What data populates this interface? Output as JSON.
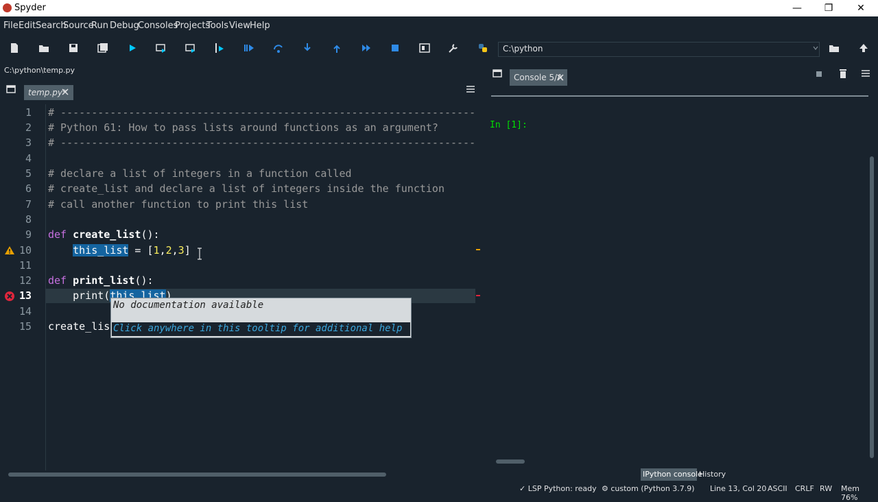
{
  "window": {
    "title": "Spyder",
    "minimize": "—",
    "maximize": "❐",
    "close": "✕"
  },
  "menu": [
    "File",
    "Edit",
    "Search",
    "Source",
    "Run",
    "Debug",
    "Consoles",
    "Projects",
    "Tools",
    "View",
    "Help"
  ],
  "toolbar": {
    "working_dir": "C:\\python",
    "icons": [
      "new-file-icon",
      "open-folder-icon",
      "save-icon",
      "save-all-icon",
      "run-icon",
      "run-cell-icon",
      "run-cell-advance-icon",
      "run-selection-icon",
      "debug-icon",
      "step-icon",
      "step-into-icon",
      "step-return-icon",
      "continue-icon",
      "stop-icon",
      "maximize-pane-icon",
      "preferences-icon",
      "python-path-icon"
    ]
  },
  "editor": {
    "path": "C:\\python\\temp.py",
    "tab_label": "temp.py*",
    "lines": [
      "1",
      "2",
      "3",
      "4",
      "5",
      "6",
      "7",
      "8",
      "9",
      "10",
      "11",
      "12",
      "13",
      "14",
      "15"
    ],
    "code": {
      "l1": "# -----------------------------------------------------------------------",
      "l2": "# Python 61: How to pass lists around functions as an argument?",
      "l3": "# -----------------------------------------------------------------------",
      "l5": "# declare a list of integers in a function called",
      "l6": "# create_list and declare a list of integers inside the function",
      "l7": "# call another function to print this list",
      "l9_kw": "def",
      "l9_fn": "create_list",
      "l9_rest": "():",
      "l10_var": "this_list",
      "l10_eq": " = [",
      "l10_n1": "1",
      "l10_n2": "2",
      "l10_n3": "3",
      "l12_kw": "def",
      "l12_fn": "print_list",
      "l12_rest": "():",
      "l13_print": "print(",
      "l13_var": "this_list",
      "l13_end": ")",
      "l15": "create_lis"
    },
    "tooltip": {
      "line1": "No documentation available",
      "line2": "Click anywhere in this tooltip for additional help"
    }
  },
  "console": {
    "tab_label": "Console 5/A",
    "prompt": "In [1]:",
    "bottom_tabs": [
      "IPython console",
      "History"
    ]
  },
  "status": {
    "lsp": "LSP Python: ready",
    "env": "custom (Python 3.7.9)",
    "pos": "Line 13, Col 20",
    "encoding": "ASCII",
    "eol": "CRLF",
    "mode": "RW",
    "mem": "Mem 76%"
  }
}
